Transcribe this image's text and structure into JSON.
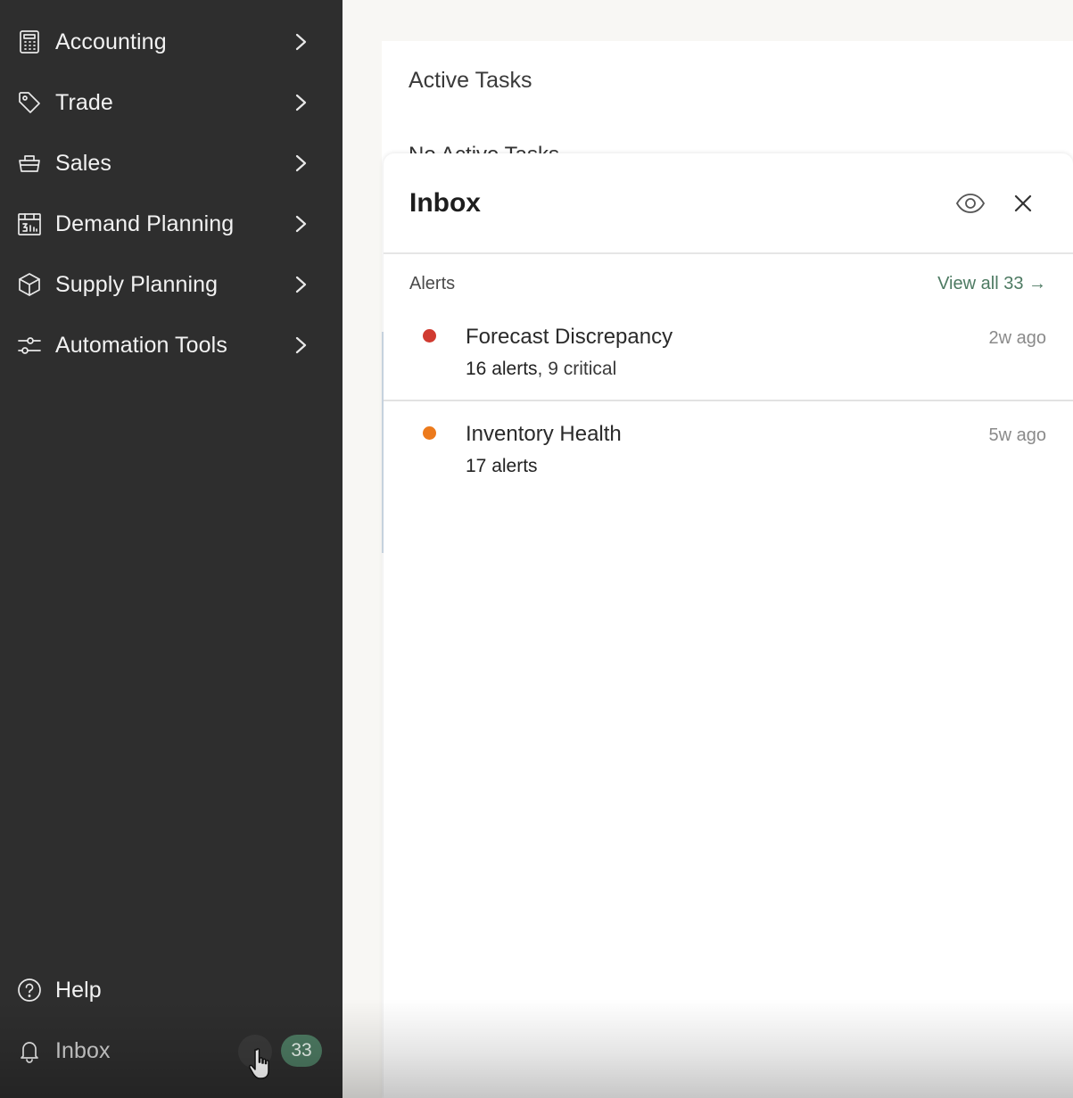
{
  "sidebar": {
    "items": [
      {
        "label": "Accounting",
        "icon": "calculator-icon"
      },
      {
        "label": "Trade",
        "icon": "tag-icon"
      },
      {
        "label": "Sales",
        "icon": "basket-icon"
      },
      {
        "label": "Demand Planning",
        "icon": "calendar-chart-icon"
      },
      {
        "label": "Supply Planning",
        "icon": "box-icon"
      },
      {
        "label": "Automation Tools",
        "icon": "sliders-icon"
      }
    ],
    "help_label": "Help",
    "inbox_label": "Inbox",
    "inbox_count": "33"
  },
  "background": {
    "title": "Active Tasks",
    "peek_text": "No Active Tasks"
  },
  "inbox_panel": {
    "title": "Inbox",
    "section_label": "Alerts",
    "view_all": "View all 33 →",
    "alerts": [
      {
        "title": "Forecast Discrepancy",
        "count_text": "16 alerts",
        "extra_text": ", 9 critical",
        "time": "2w ago",
        "color": "#d03a30"
      },
      {
        "title": "Inventory Health",
        "count_text": "17 alerts",
        "extra_text": "",
        "time": "5w ago",
        "color": "#ec7a1c"
      }
    ]
  },
  "colors": {
    "sidebar_bg": "#2e2e2e",
    "accent_green": "#4d7a62",
    "critical_red": "#d03a30",
    "warning_orange": "#ec7a1c"
  }
}
